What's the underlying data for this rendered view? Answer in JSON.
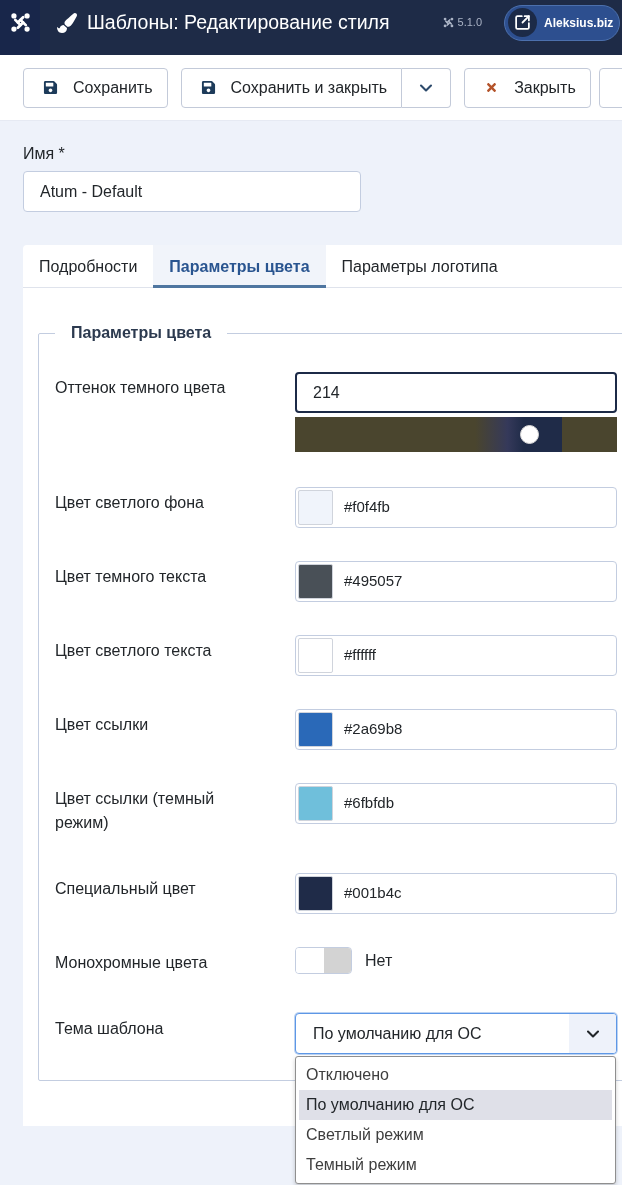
{
  "header": {
    "title": "Шаблоны: Редактирование стиля",
    "version": "5.1.0",
    "site_link": "Aleksius.biz"
  },
  "toolbar": {
    "buttons": [
      {
        "kind": "save",
        "label": "Сохранить"
      },
      {
        "kind": "save_split",
        "label": "Сохранить и закрыть"
      },
      {
        "kind": "close",
        "label": "Закрыть"
      },
      {
        "kind": "partial"
      }
    ]
  },
  "name_field": {
    "label": "Имя *",
    "value": "Atum - Default"
  },
  "tabs": [
    {
      "label": "Подробности",
      "selected": false
    },
    {
      "label": "Параметры цвета",
      "selected": true
    },
    {
      "label": "Параметры логотипа",
      "selected": false
    }
  ],
  "color_fieldset": {
    "legend": "Параметры цвета",
    "rows": [
      {
        "kind": "hue",
        "label": "Оттенок темного цвета",
        "value": "214",
        "level": 0.73
      },
      {
        "kind": "color",
        "label": "Цвет светлого фона",
        "value": "#f0f4fb",
        "color": "#f0f4fb"
      },
      {
        "kind": "color",
        "label": "Цвет темного текста",
        "value": "#495057",
        "color": "#495057"
      },
      {
        "kind": "color",
        "label": "Цвет светлого текста",
        "value": "#ffffff",
        "color": "#ffffff"
      },
      {
        "kind": "color",
        "label": "Цвет ссылки",
        "value": "#2a69b8",
        "color": "#2a69b8"
      },
      {
        "kind": "color",
        "label": "Цвет ссылки (темный режим)",
        "value": "#6fbfdb",
        "color": "#6fbfdb"
      },
      {
        "kind": "color",
        "label": "Специальный цвет",
        "value": "#001b4c",
        "color": "#1f2b48"
      },
      {
        "kind": "switch",
        "label": "Монохромные цвета",
        "on": false,
        "value": "Нет"
      },
      {
        "kind": "select",
        "label": "Тема шаблона",
        "value": "По умолчанию для ОС",
        "expanded": true,
        "options": [
          {
            "label": "Отключено",
            "selected": false
          },
          {
            "label": "По умолчанию для ОС",
            "selected": true
          },
          {
            "label": "Светлый режим",
            "selected": false
          },
          {
            "label": "Темный режим",
            "selected": false
          }
        ]
      }
    ]
  }
}
